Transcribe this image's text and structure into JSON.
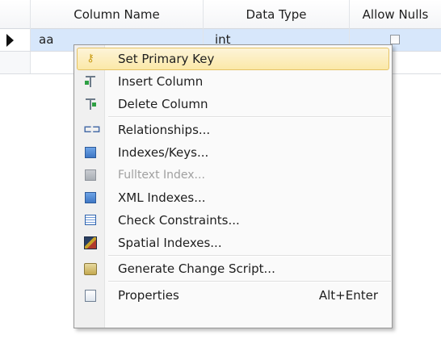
{
  "grid": {
    "headers": {
      "column_name": "Column Name",
      "data_type": "Data Type",
      "allow_nulls": "Allow Nulls"
    },
    "rows": [
      {
        "name": "aa",
        "type": "int",
        "allow_nulls": false,
        "selected": true
      }
    ]
  },
  "context_menu": {
    "items": [
      {
        "label": "Set Primary Key",
        "icon": "key-icon",
        "enabled": true,
        "hovered": true
      },
      {
        "label": "Insert Column",
        "icon": "insert-column-icon",
        "enabled": true
      },
      {
        "label": "Delete Column",
        "icon": "delete-column-icon",
        "enabled": true
      },
      {
        "label": "Relationships...",
        "icon": "relationships-icon",
        "enabled": true
      },
      {
        "label": "Indexes/Keys...",
        "icon": "indexes-keys-icon",
        "enabled": true
      },
      {
        "label": "Fulltext Index...",
        "icon": "fulltext-index-icon",
        "enabled": false
      },
      {
        "label": "XML Indexes...",
        "icon": "xml-indexes-icon",
        "enabled": true
      },
      {
        "label": "Check Constraints...",
        "icon": "check-constraints-icon",
        "enabled": true
      },
      {
        "label": "Spatial Indexes...",
        "icon": "spatial-indexes-icon",
        "enabled": true
      },
      {
        "label": "Generate Change Script...",
        "icon": "generate-script-icon",
        "enabled": true
      },
      {
        "label": "Properties",
        "icon": "properties-icon",
        "enabled": true,
        "shortcut": "Alt+Enter"
      }
    ]
  },
  "colors": {
    "selected_row": "#d7e7fb",
    "hover_fill": "#fbe8a7",
    "hover_border": "#e5c365",
    "disabled_text": "#a0a0a0"
  }
}
